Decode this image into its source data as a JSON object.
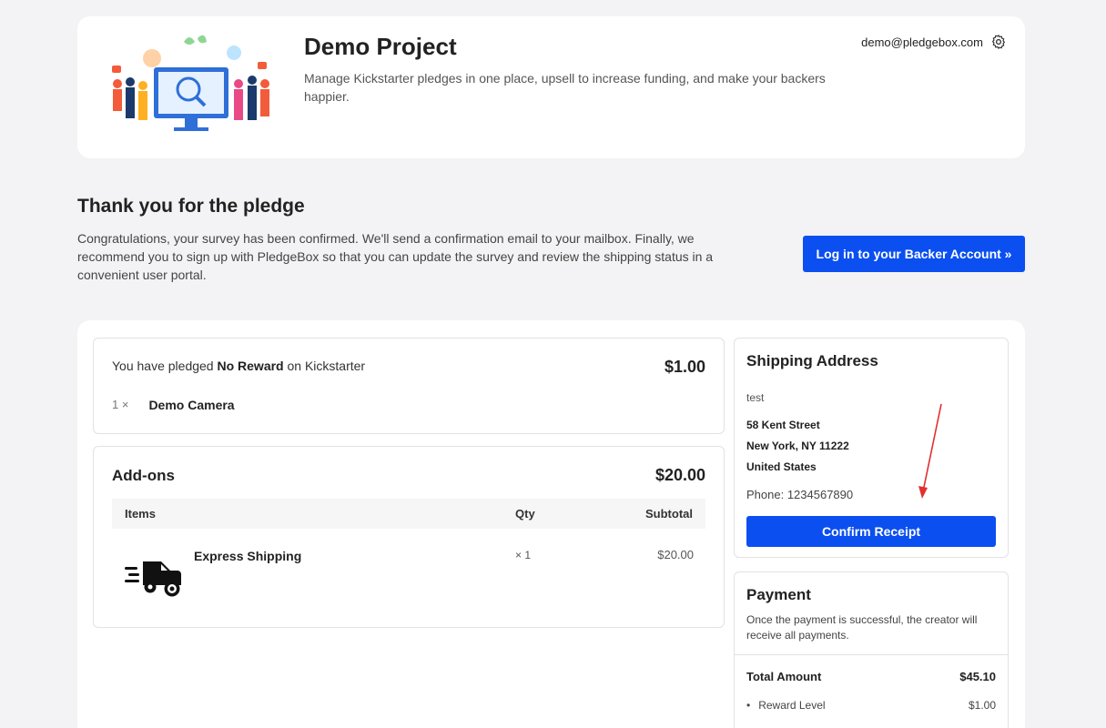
{
  "header": {
    "project_title": "Demo Project",
    "project_description": "Manage Kickstarter pledges in one place, upsell to increase funding, and make your backers happier.",
    "account_email": "demo@pledgebox.com"
  },
  "thanks": {
    "title": "Thank you for the pledge",
    "message": "Congratulations, your survey has been confirmed. We'll send a confirmation email to your mailbox. Finally, we recommend you to sign up with PledgeBox so that you can update the survey and review the shipping status in a convenient user portal.",
    "login_button": "Log in to your Backer Account »"
  },
  "pledge": {
    "prefix": "You have pledged",
    "reward": "No Reward",
    "suffix": "on Kickstarter",
    "amount": "$1.00",
    "item_qty": "1 ×",
    "item_name": "Demo Camera"
  },
  "addons": {
    "title": "Add-ons",
    "amount": "$20.00",
    "columns": {
      "items": "Items",
      "qty": "Qty",
      "subtotal": "Subtotal"
    },
    "rows": [
      {
        "name": "Express Shipping",
        "qty": "× 1",
        "subtotal": "$20.00",
        "icon": "truck-icon"
      }
    ]
  },
  "shipping": {
    "title": "Shipping Address",
    "name": "test",
    "street": "58 Kent Street",
    "city": "New York, NY 11222",
    "country": "United States",
    "phone": "Phone: 1234567890",
    "confirm_button": "Confirm Receipt"
  },
  "payment": {
    "title": "Payment",
    "description": "Once the payment is successful, the creator will receive all payments.",
    "total_label": "Total Amount",
    "total_value": "$45.10",
    "lines": [
      {
        "label": "Reward Level",
        "value": "$1.00"
      }
    ]
  },
  "colors": {
    "accent": "#0b4ff0",
    "annotation_arrow": "#e03131"
  }
}
